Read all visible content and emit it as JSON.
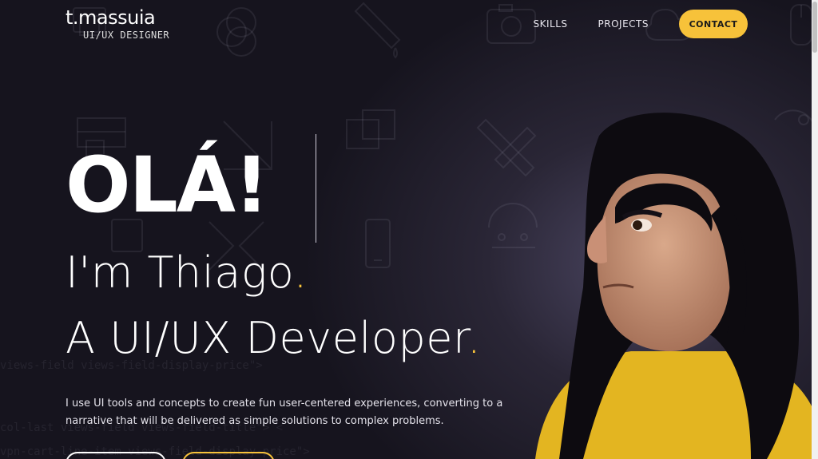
{
  "logo": {
    "name": "t.massuia",
    "subtitle": "UI/UX DESIGNER"
  },
  "nav": {
    "skills": "SKILLS",
    "projects": "PROJECTS",
    "contact": "CONTACT"
  },
  "hero": {
    "greeting": "OLÁ!",
    "line1": "I'm Thiago",
    "line2": "A UI/UX Developer",
    "dot": ".",
    "intro": "I use UI tools and concepts to create fun user-centered experiences, converting to a narrative that will be delivered as simple solutions to complex problems."
  },
  "background_code": {
    "line1": "views-field views-field-display-price\">",
    "line2": "col-last views-field views-field-title\"> <",
    "line3": "vpn-cart-line-item views-field-display-price\"> "
  },
  "colors": {
    "accent": "#f7c23a",
    "background": "#16141e",
    "text": "#ffffff"
  }
}
